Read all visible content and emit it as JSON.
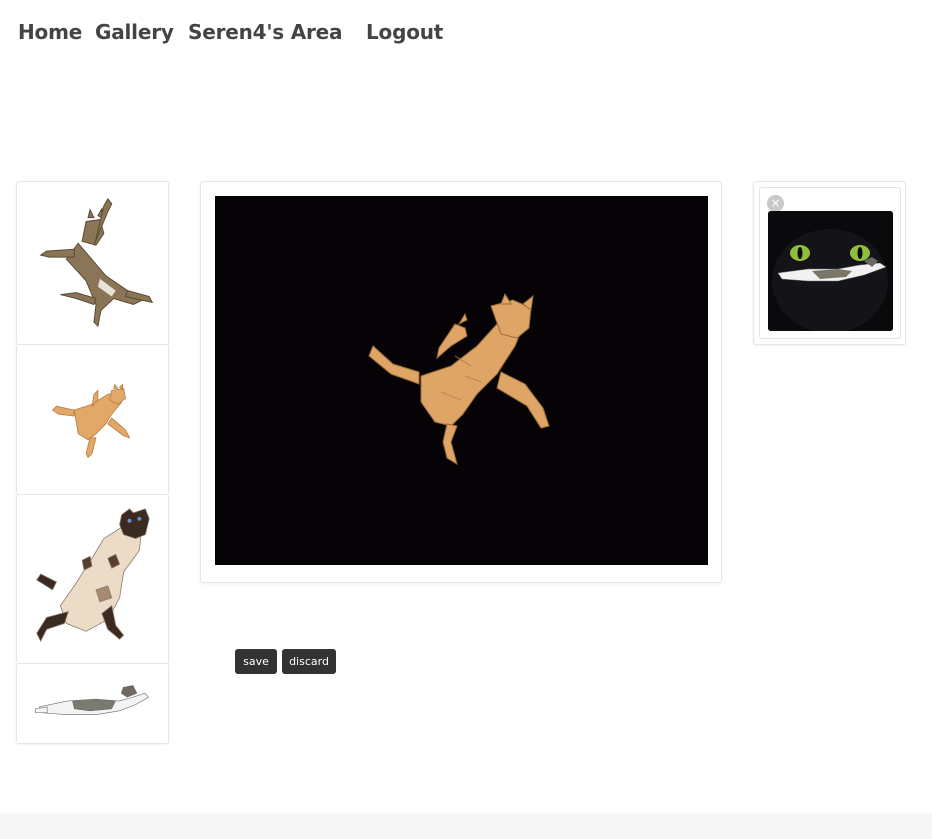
{
  "nav": {
    "items": [
      {
        "label": "Home"
      },
      {
        "label": "Gallery"
      },
      {
        "label": "Seren4's Area"
      },
      {
        "label": "Logout"
      }
    ]
  },
  "thumbnails": [
    {
      "subject": "tabby-cat-leaping"
    },
    {
      "subject": "orange-cat-leaping"
    },
    {
      "subject": "siamese-cat-falling"
    },
    {
      "subject": "white-tabby-cat-stretching"
    }
  ],
  "main_image": {
    "subject": "orange-cat-leaping-on-black"
  },
  "side_card": {
    "remove_icon": "×",
    "image_subject": "black-cat-with-green-eyes-and-leaping-cat"
  },
  "actions": {
    "save_label": "save",
    "discard_label": "discard"
  },
  "colors": {
    "nav_text": "#444444",
    "button_bg": "#333333",
    "main_image_bg": "#060306"
  }
}
